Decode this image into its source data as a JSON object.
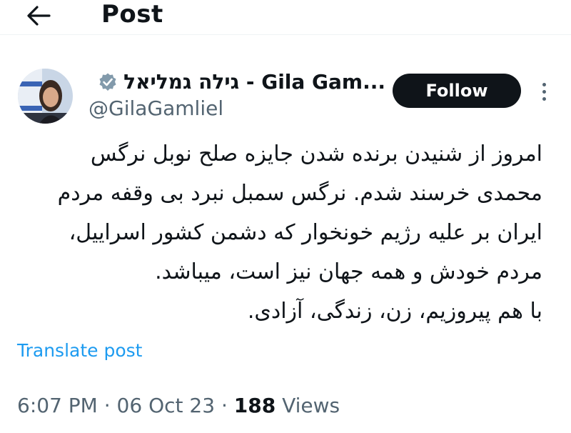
{
  "header": {
    "back_icon": "arrow-left-icon",
    "title": "Post"
  },
  "author": {
    "display_name": "גילה גמליאל - Gila Gam...",
    "handle": "@GilaGamliel",
    "verified_icon": "verified-badge-icon",
    "verified_color": "#829aab",
    "avatar": "profile-photo"
  },
  "actions": {
    "follow_label": "Follow",
    "more_icon": "more-vertical-icon"
  },
  "tweet": {
    "lines": [
      "امروز از شنیدن برنده شدن جایزه صلح نوبل نرگس",
      "محمدی خرسند شدم. نرگس سمبل نبرد بی وقفه مردم",
      "ایران بر علیه رژیم خونخوار که دشمن کشور اسراییل،",
      "مردم خودش و همه جهان نیز است، میباشد.",
      "با هم پیروزیم، زن، زندگی، آزادی."
    ],
    "translate_label": "Translate post"
  },
  "meta": {
    "time": "6:07 PM",
    "date": "06 Oct 23",
    "separator": "·",
    "views_count": "188",
    "views_label": "Views"
  },
  "colors": {
    "link": "#1d9bf0",
    "secondary_text": "#536471",
    "primary_text": "#0f1419",
    "follow_bg": "#0f1419"
  }
}
